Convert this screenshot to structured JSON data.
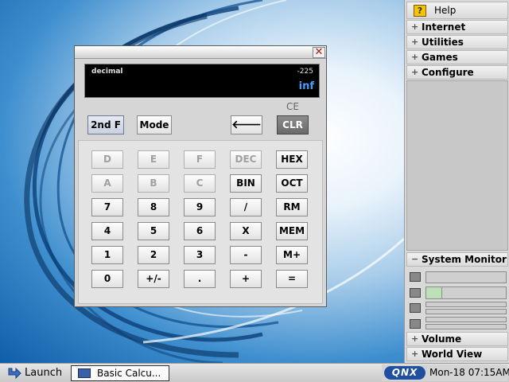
{
  "desktop": {
    "colors": {
      "wallpaper_dark": "#0f5ea9",
      "wallpaper_light": "#e9f3fb"
    }
  },
  "shelf": {
    "help_label": "Help",
    "help_icon": "help-book-icon",
    "menus": [
      {
        "label": "Internet",
        "expander": "+"
      },
      {
        "label": "Utilities",
        "expander": "+"
      },
      {
        "label": "Games",
        "expander": "+"
      },
      {
        "label": "Configure",
        "expander": "+"
      }
    ],
    "system_monitor": {
      "label": "System Monitor",
      "expander": "−",
      "cpu_icon": "cpu-icon",
      "memory_icon": "memory-icon",
      "disk_icon": "disk-icon",
      "network_icon": "network-icon",
      "memory_usage_fraction": 0.2
    },
    "volume_label": "Volume",
    "volume_expander": "+",
    "world_view_label": "World View",
    "world_view_expander": "+"
  },
  "taskbar": {
    "launch_label": "Launch",
    "launch_icon": "launch-arrow-icon",
    "task_label": "Basic Calcu...",
    "task_icon": "calculator-window-icon",
    "logo_text": "QNX",
    "clock": "Mon-18 07:15AM"
  },
  "calculator": {
    "close_glyph": "✕",
    "display": {
      "mode": "decimal",
      "memory": "-225",
      "result": "inf"
    },
    "ce_label": "CE",
    "top_buttons": {
      "second_f": "2nd F",
      "mode": "Mode",
      "back": "🡐",
      "clear": "CLR"
    },
    "keys": [
      [
        "D",
        "E",
        "F",
        "DEC",
        "HEX"
      ],
      [
        "A",
        "B",
        "C",
        "BIN",
        "OCT"
      ],
      [
        "7",
        "8",
        "9",
        "/",
        "RM"
      ],
      [
        "4",
        "5",
        "6",
        "X",
        "MEM"
      ],
      [
        "1",
        "2",
        "3",
        "-",
        "M+"
      ],
      [
        "0",
        "+/-",
        ".",
        "+",
        "="
      ]
    ],
    "disabled_keys": [
      "D",
      "E",
      "F",
      "DEC",
      "A",
      "B",
      "C"
    ]
  }
}
